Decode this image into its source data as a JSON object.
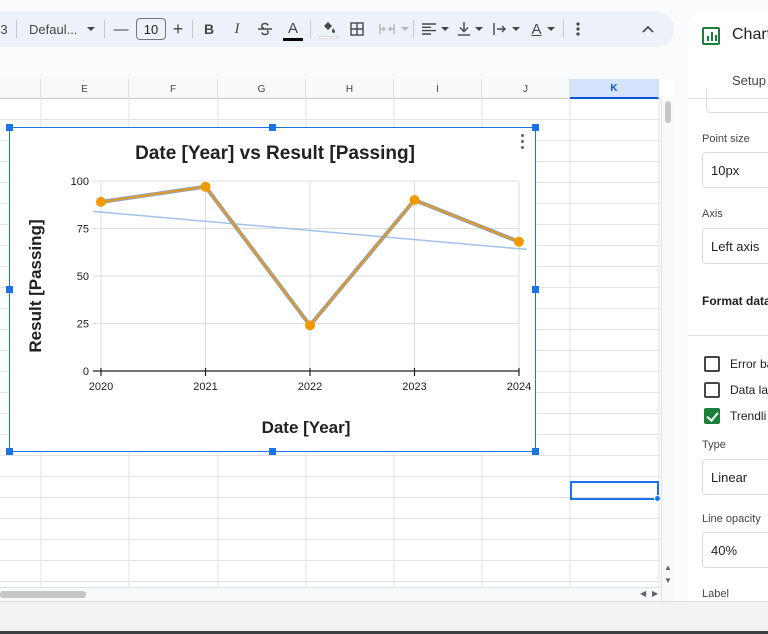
{
  "toolbar": {
    "partial_left": "3",
    "font_name": "Defaul...",
    "font_size": "10",
    "minus": "—",
    "plus": "+",
    "bold": "B",
    "italic": "I",
    "text_color_letter": "A",
    "text_rotation_letter": "A",
    "accent_text_color": "#000000"
  },
  "sheet": {
    "columns": [
      "E",
      "F",
      "G",
      "H",
      "I",
      "J",
      "K"
    ],
    "selected_column": "K"
  },
  "chart_data": {
    "type": "line",
    "title": "Date [Year] vs Result [Passing]",
    "xlabel": "Date [Year]",
    "ylabel": "Result [Passing]",
    "categories": [
      "2020",
      "2021",
      "2022",
      "2023",
      "2024"
    ],
    "x": [
      2020,
      2021,
      2022,
      2023,
      2024
    ],
    "series": [
      {
        "values": [
          89,
          97,
          24,
          90,
          68
        ],
        "color": "#f29900",
        "line_color": "#9aa0a6"
      }
    ],
    "trendline": {
      "type": "linear",
      "opacity": "40%",
      "color": "#a1c2ee",
      "start": 84,
      "end": 64
    },
    "yticks": [
      0,
      25,
      50,
      75,
      100
    ],
    "ylim": [
      0,
      100
    ],
    "grid": true
  },
  "panel": {
    "title": "Chart",
    "tab": "Setup",
    "point_size_label": "Point size",
    "point_size_value": "10px",
    "axis_label": "Axis",
    "axis_value": "Left axis",
    "format_heading": "Format data",
    "checkboxes": [
      {
        "label": "Error ba",
        "checked": false
      },
      {
        "label": "Data la",
        "checked": false
      },
      {
        "label": "Trendli",
        "checked": true
      }
    ],
    "type_label": "Type",
    "type_value": "Linear",
    "opacity_label": "Line opacity",
    "opacity_value": "40%",
    "label_label": "Label",
    "accent_color": "#188038"
  }
}
